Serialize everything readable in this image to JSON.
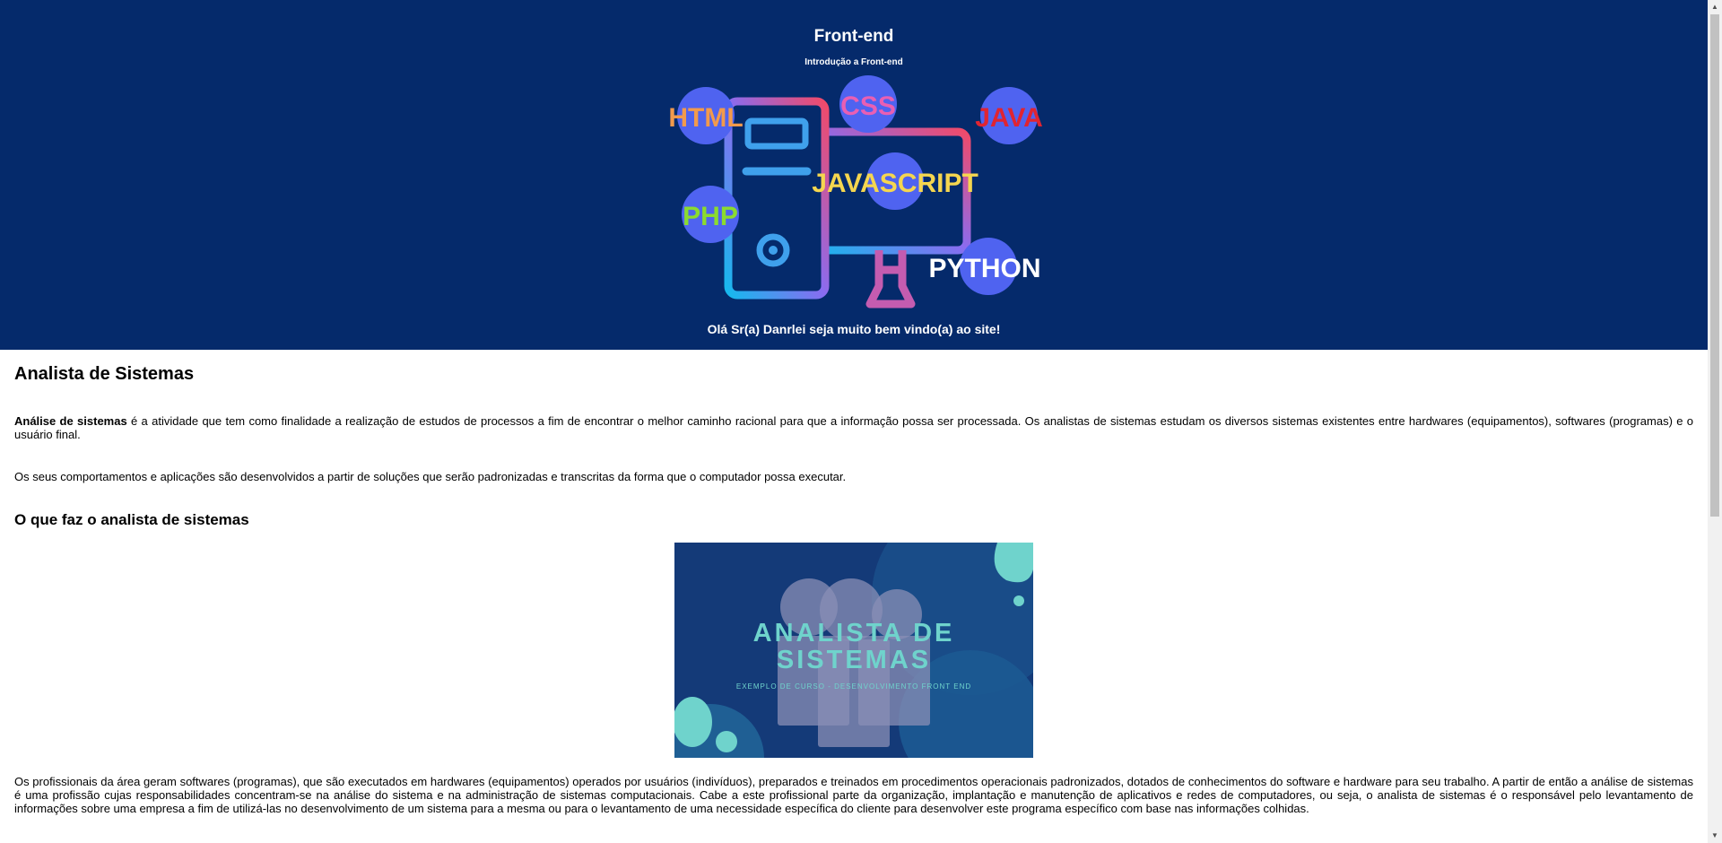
{
  "header": {
    "title": "Front-end",
    "subtitle": "Introdução a Front-end",
    "welcome": "Olá Sr(a) Danrlei seja muito bem vindo(a) ao site!"
  },
  "hero": {
    "badges": [
      "HTML",
      "CSS",
      "JAVA",
      "JAVASCRIPT",
      "PHP",
      "PYTHON"
    ],
    "colors": {
      "bg": "#052a6b",
      "bubble": "#4f63f0",
      "html": "#f29a4c",
      "css": "#e95fb3",
      "java": "#e02431",
      "javascript": "#f5d64f",
      "php": "#8bdb2f",
      "python": "#ffffff"
    }
  },
  "main": {
    "heading": "Analista de Sistemas",
    "p1_strong": "Análise de sistemas",
    "p1_rest": " é a atividade que tem como finalidade a realização de estudos de processos a fim de encontrar o melhor caminho racional para que a informação possa ser processada. Os analistas de sistemas estudam os diversos sistemas existentes entre hardwares (equipamentos), softwares (programas) e o usuário final.",
    "p2": "Os seus comportamentos e aplicações são desenvolvidos a partir de soluções que serão padronizadas e transcritas da forma que o computador possa executar.",
    "subheading": "O que faz o analista de sistemas",
    "figure": {
      "title_line1": "ANALISTA DE",
      "title_line2": "SISTEMAS",
      "caption": "EXEMPLO DE CURSO - DESENVOLVIMENTO FRONT END"
    },
    "p3": "Os profissionais da área geram softwares (programas), que são executados em hardwares (equipamentos) operados por usuários (indivíduos), preparados e treinados em procedimentos operacionais padronizados, dotados de conhecimentos do software e hardware para seu trabalho. A partir de então a análise de sistemas é uma profissão cujas responsabilidades concentram-se na análise do sistema e na administração de sistemas computacionais. Cabe a este profissional parte da organização, implantação e manutenção de aplicativos e redes de computadores, ou seja, o analista de sistemas é o responsável pelo levantamento de informações sobre uma empresa a fim de utilizá-las no desenvolvimento de um sistema para a mesma ou para o levantamento de uma necessidade específica do cliente para desenvolver este programa específico com base nas informações colhidas."
  }
}
